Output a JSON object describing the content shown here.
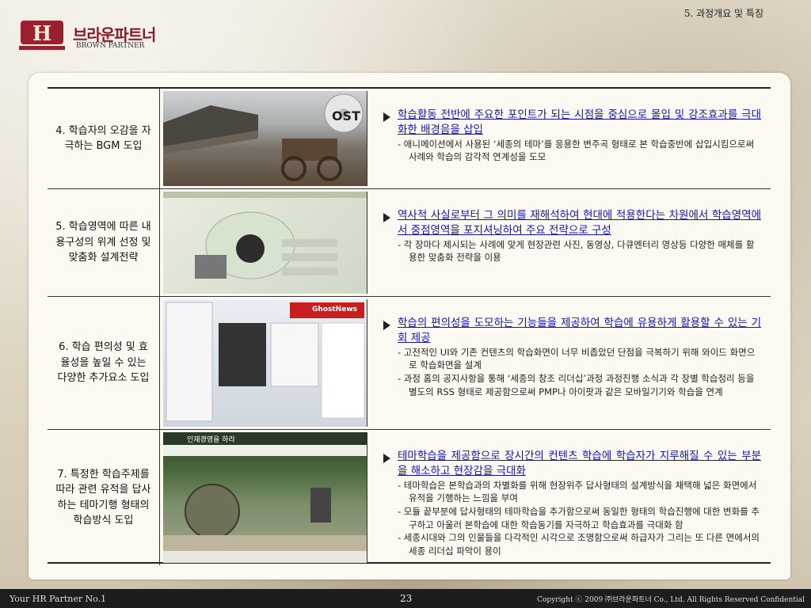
{
  "header": {
    "section_title": "5. 과정개요 및 특징",
    "logo_kr": "브라운파트너",
    "logo_en": "BROWN PARTNER"
  },
  "rows": [
    {
      "label": "4. 학습자의 오감을 자극하는 BGM 도입",
      "headline": "학습활동 전반에 주요한 포인트가 되는 시점을 중심으로 몰입 및 강조효과를 극대화한 배경음을 삽입",
      "details": [
        "- 애니메이션에서 사용된 ‘세종의 테마’를 응용한 변주곡 형태로 본 학습중반에 삽입시킴으로써 사례와 학습의 감각적 연계성을 도모"
      ],
      "image_text": "OST"
    },
    {
      "label": "5. 학습영역에 따른 내용구성의 위계 선정 및 맞춤화 설계전략",
      "headline": "역사적 사실로부터 그 의미를 재해석하여 현대에 적용한다는 차원에서 학습영역에서 중점영역을 포지셔닝하여 주요 전략으로 구성",
      "details": [
        "- 각 장마다 제시되는 사례에 맞게 현장관련 사진, 동영상, 다큐멘터리 영상등 다양한 매체를 활용한 맞춤화 전략을 이용"
      ]
    },
    {
      "label": "6. 학습 편의성 및 효율성을 높일 수 있는 다양한 추가요소 도입",
      "headline": "학습의 편의성을 도모하는 기능들을 제공하여 학습에 유용하게 활용할 수 있는 기회 제공",
      "details": [
        "- 고전적인 UI와 기존 컨텐츠의 학습화면이 너무 비좁았던 단점을 극복하기 위해 와이드 화면으로 학습화면을 설계",
        "- 과정 홈의 공지사항을 통해 ‘세종의 창조 리더십’과정 과정진행 소식과 각 장별 학습정리 등을 별도의 RSS 형태로 제공함으로써 PMP나 아이팟과 같은 모바일기기와 학습을 연계"
      ],
      "image_text": "GhostNews"
    },
    {
      "label": "7. 특정한 학습주제를 따라 관련 유적을 답사하는 테마기행 형태의 학습방식 도입",
      "headline": "테마학습을 제공함으로 장시간의 컨텐츠 학습에 학습자가 지루해질 수 있는 부분을 해소하고 현장감을 극대화",
      "details": [
        "- 테마학습은 본학습과의 차별화를 위해 현장위주 답사형태의 설계방식을 채택해 넓은 화면에서 유적을 기행하는 느낌을 부여",
        "- 모듈 끝부분에 답사형태의 테마학습을 추가함으로써 동일한 형태의 학습진행에 대한 변화를 추구하고 아울러 본학습에 대한 학습동기를 자극하고 학습효과를 극대화 함",
        "- 세종시대와 그의 인물들을 다각적인 시각으로 조명함으로써 하급자가 그리는 또 다른 면에서의 세종 리더십 파악이 용이"
      ],
      "image_text": "인재경영을 하라"
    }
  ],
  "footer": {
    "left": "Your HR Partner No.1",
    "page": "23",
    "right": "Copyright ⓒ 2009 ㈜브라운파트너 Co., Ltd. All Rights Reserved Confidential"
  }
}
